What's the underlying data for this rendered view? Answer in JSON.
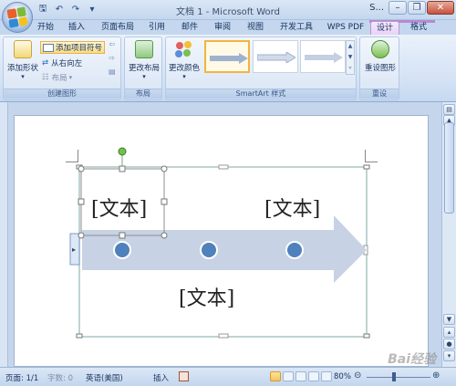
{
  "window": {
    "title": "文档 1 - Microsoft Word",
    "title_suffix": "S..."
  },
  "tabs": [
    "开始",
    "插入",
    "页面布局",
    "引用",
    "邮件",
    "审阅",
    "视图",
    "开发工具",
    "WPS PDF",
    "设计",
    "格式"
  ],
  "ribbon": {
    "create_group": {
      "label": "创建图形",
      "add_bullet": "添加项目符号",
      "add_shape": "添加形状",
      "right_to_left": "从右向左",
      "layout": "布局"
    },
    "layout_group": {
      "label": "布局",
      "change_layout": "更改布局"
    },
    "styles_group": {
      "label": "SmartArt 样式",
      "change_colors": "更改颜色"
    },
    "reset_group": {
      "label": "重设",
      "reset_graphic": "重设图形"
    }
  },
  "smartart": {
    "text_1": "[文本]",
    "text_2": "[文本]",
    "text_3": "[文本]",
    "colors": {
      "arrow": "#c7d2e4",
      "circle": "#4f81bd",
      "circle_border": "#ffffff",
      "frame": "#a8c6c4"
    }
  },
  "statusbar": {
    "page": "页面: 1/1",
    "words": "字数: 0",
    "language": "英语(美国)",
    "insert_mode": "插入",
    "zoom": "80%"
  },
  "watermark": "Bai经验"
}
